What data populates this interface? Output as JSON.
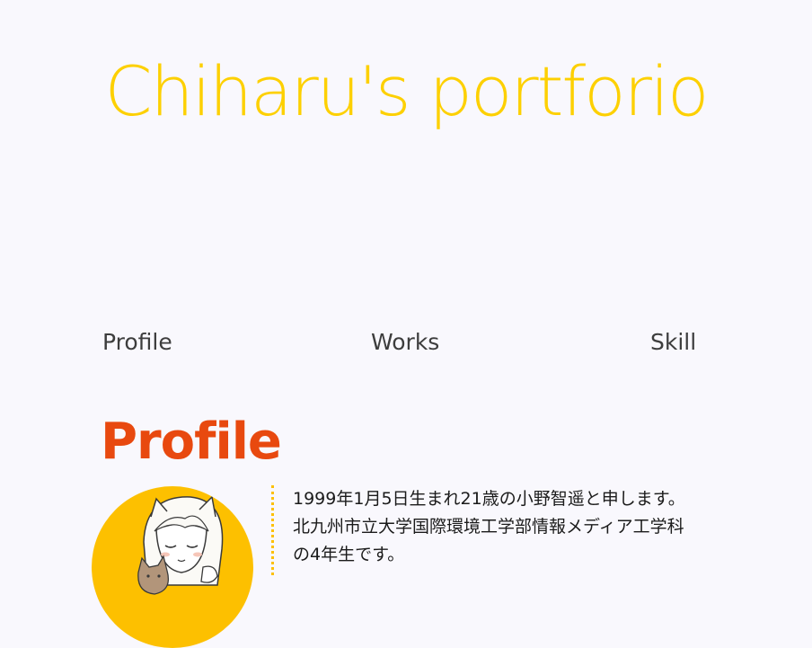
{
  "header": {
    "title": "Chiharu's portforio"
  },
  "nav": {
    "items": [
      {
        "label": "Profile"
      },
      {
        "label": "Works"
      },
      {
        "label": "Skill"
      }
    ]
  },
  "profile": {
    "heading": "Profile",
    "bio_lines": [
      "1999年1月5日生まれ21歳の小野智遥と申します。",
      "北九州市立大学国際環境工学部情報メディア工学科",
      "の4年生です。"
    ]
  },
  "colors": {
    "title": "#fdd000",
    "heading": "#e8490f",
    "avatar_bg": "#fdc000",
    "background": "#f9f8fd",
    "text": "#1b1b1b"
  }
}
